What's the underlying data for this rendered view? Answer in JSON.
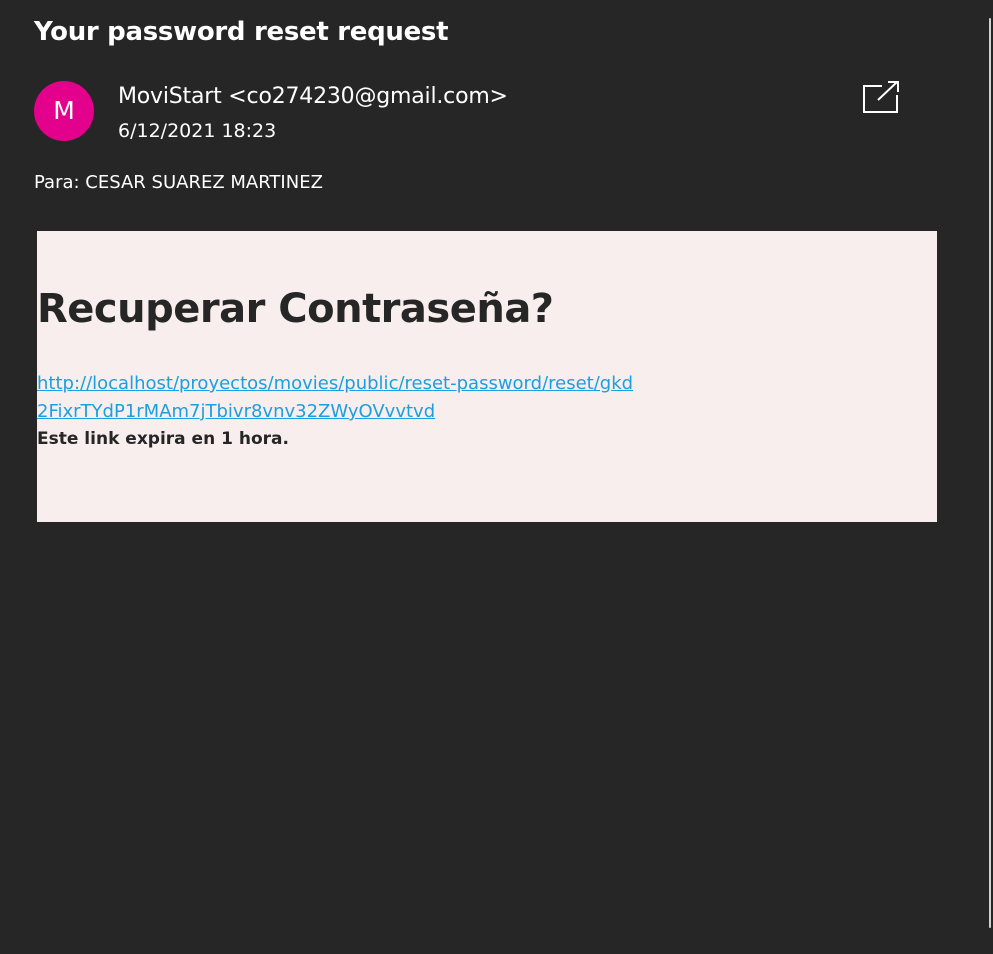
{
  "message": {
    "subject": "Your password reset request",
    "sender": {
      "initial": "M",
      "display": "MoviStart <co274230@gmail.com>",
      "avatar_color": "#e3008c"
    },
    "date": "6/12/2021 18:23",
    "to_line": "Para: CESAR SUAREZ MARTINEZ",
    "actions": {
      "popout_icon": "open-in-new-window-icon"
    }
  },
  "email_body": {
    "background_color": "#f8eeed",
    "heading": "Recuperar Contraseña?",
    "link_text": "http://localhost/proyectos/movies/public/reset-password/reset/gkd2FixrTYdP1rMAm7jTbivr8vnv32ZWyOVvvtvd",
    "link_color": "#1a9fe0",
    "expiry_note": "Este link expira en 1 hora."
  }
}
